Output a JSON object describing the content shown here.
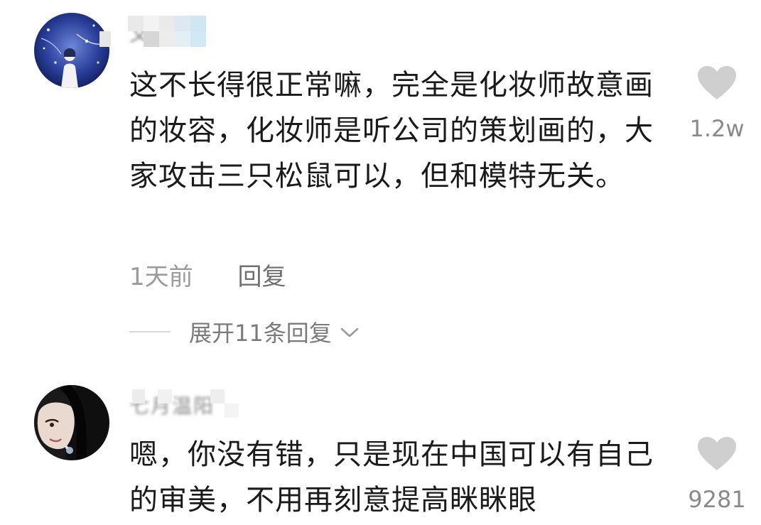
{
  "comments": [
    {
      "username": "文溶IM)",
      "text": "这不长得很正常嘛，完全是化妆师故意画的妆容，化妆师是听公司的策划画的，大家攻击三只松鼠可以，但和模特无关。",
      "time": "1天前",
      "reply_label": "回复",
      "like_count": "1.2w",
      "expand_label": "展开11条回复"
    },
    {
      "username": "七月温阳",
      "text": "嗯，你没有错，只是现在中国可以有自己的审美，不用再刻意提高眯眯眼",
      "like_count": "9281"
    }
  ],
  "icons": {
    "heart": "heart-icon",
    "chevron": "chevron-down-icon",
    "heart_color": "#cfcfcf"
  }
}
